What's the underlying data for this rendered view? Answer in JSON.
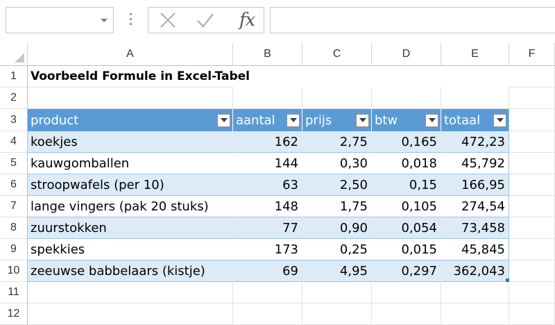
{
  "formula_bar": {
    "name_box": "",
    "formula": "",
    "cancel_icon": "close-icon",
    "enter_icon": "check-icon",
    "fx_label": "fx"
  },
  "columns": [
    "A",
    "B",
    "C",
    "D",
    "E",
    "F"
  ],
  "rows": [
    "1",
    "2",
    "3",
    "4",
    "5",
    "6",
    "7",
    "8",
    "9",
    "10",
    "11",
    "12"
  ],
  "sheet": {
    "title": "Voorbeeld Formule in Excel-Tabel",
    "table": {
      "headers": [
        "product",
        "aantal",
        "prijs",
        "btw",
        "totaal"
      ],
      "rows": [
        [
          "koekjes",
          "162",
          "2,75",
          "0,165",
          "472,23"
        ],
        [
          "kauwgomballen",
          "144",
          "0,30",
          "0,018",
          "45,792"
        ],
        [
          "stroopwafels (per 10)",
          "63",
          "2,50",
          "0,15",
          "166,95"
        ],
        [
          "lange vingers (pak 20 stuks)",
          "148",
          "1,75",
          "0,105",
          "274,54"
        ],
        [
          "zuurstokken",
          "77",
          "0,90",
          "0,054",
          "73,458"
        ],
        [
          "spekkies",
          "173",
          "0,25",
          "0,015",
          "45,845"
        ],
        [
          "zeeuwse babbelaars (kistje)",
          "69",
          "4,95",
          "0,297",
          "362,043"
        ]
      ]
    }
  },
  "colors": {
    "header_fill": "#5b9bd5",
    "band_fill": "#ddebf7",
    "band_border": "#9bc2e6"
  }
}
